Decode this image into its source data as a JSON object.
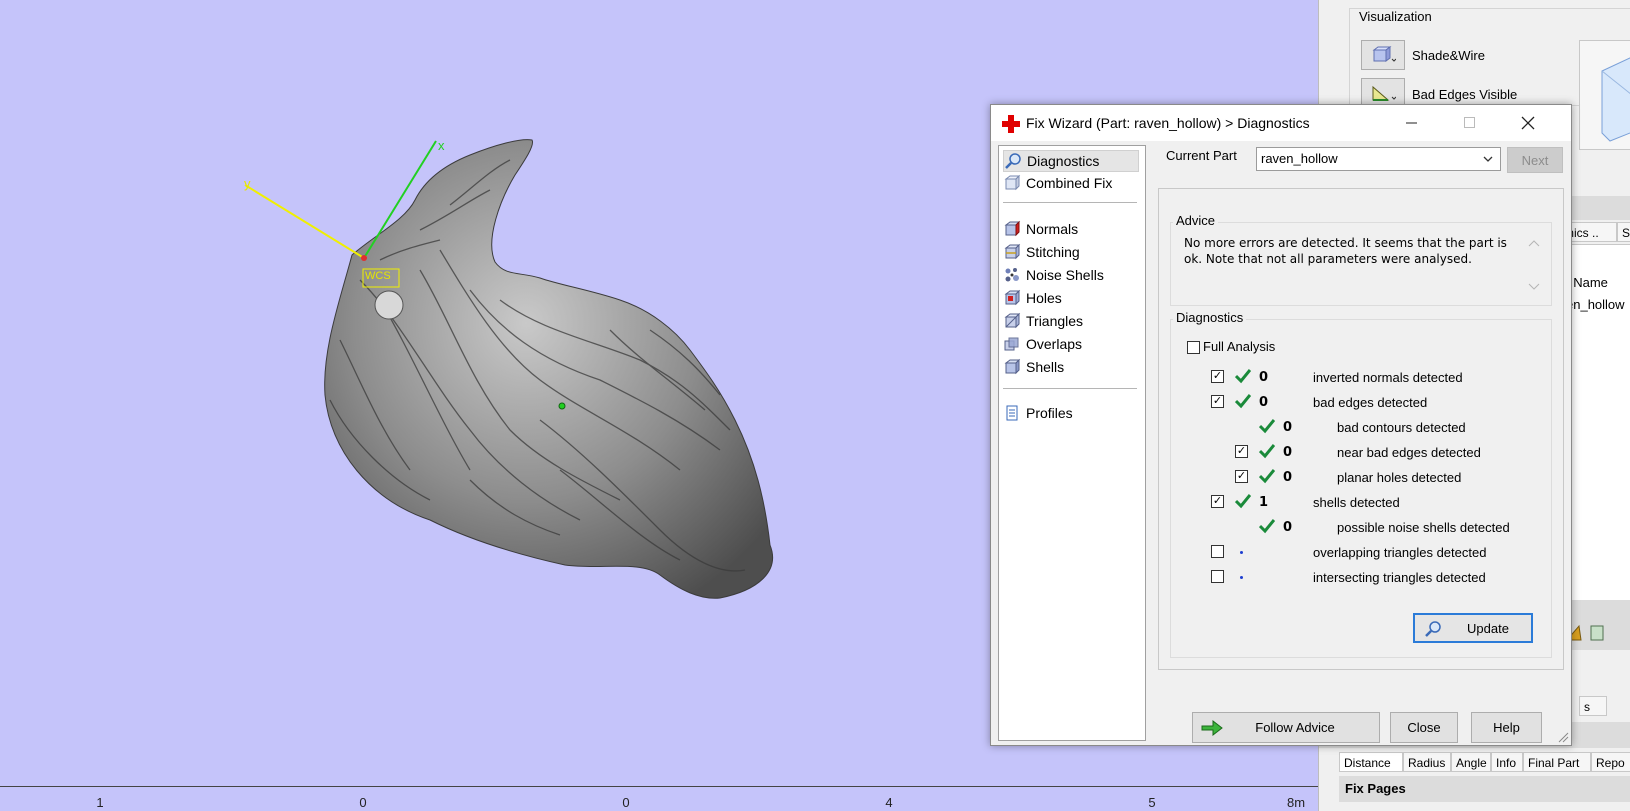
{
  "viewport": {
    "wcs_label": "WCS",
    "axis_x": "x",
    "axis_y": "y",
    "ruler_labels": [
      "1",
      "0",
      "0",
      "4",
      "5",
      "8m"
    ],
    "background": "#c5c4fa"
  },
  "right_panel": {
    "visualization_title": "Visualization",
    "shade_wire_label": "Shade&Wire",
    "bad_edges_label": "Bad Edges Visible",
    "tab_fragments": [
      "mics ..",
      "St"
    ],
    "list_fragments": [
      "t Name",
      "en_hollow"
    ],
    "small_tab": "s",
    "bottom_tabs": [
      "Distance",
      "Radius",
      "Angle",
      "Info",
      "Final Part",
      "Repo"
    ],
    "fix_pages_label": "Fix Pages"
  },
  "dialog": {
    "title": "Fix Wizard (Part: raven_hollow) > Diagnostics",
    "nav_items": [
      "Diagnostics",
      "Combined Fix",
      "Normals",
      "Stitching",
      "Noise Shells",
      "Holes",
      "Triangles",
      "Overlaps",
      "Shells",
      "Profiles"
    ],
    "current_part_label": "Current Part",
    "current_part_value": "raven_hollow",
    "next_button": "Next",
    "advice_title": "Advice",
    "advice_text": "No more errors are detected. It seems that the part is ok. Note that not all parameters were analysed.",
    "diagnostics_title": "Diagnostics",
    "full_analysis_label": "Full Analysis",
    "rows": [
      {
        "count": "0",
        "label": "inverted normals detected",
        "checked": true,
        "status": "ok"
      },
      {
        "count": "0",
        "label": "bad edges detected",
        "checked": true,
        "status": "ok"
      },
      {
        "count": "0",
        "label": "bad contours detected",
        "checked": null,
        "status": "ok"
      },
      {
        "count": "0",
        "label": "near bad edges detected",
        "checked": true,
        "status": "ok"
      },
      {
        "count": "0",
        "label": "planar holes detected",
        "checked": true,
        "status": "ok"
      },
      {
        "count": "1",
        "label": "shells detected",
        "checked": true,
        "status": "ok"
      },
      {
        "count": "0",
        "label": "possible noise shells detected",
        "checked": null,
        "status": "ok"
      },
      {
        "count": "",
        "label": "overlapping triangles detected",
        "checked": false,
        "status": "none"
      },
      {
        "count": "",
        "label": "intersecting triangles detected",
        "checked": false,
        "status": "none"
      }
    ],
    "update_button": "Update",
    "follow_advice_button": "Follow Advice",
    "close_button": "Close",
    "help_button": "Help"
  },
  "colors": {
    "check_green": "#1a8a3a",
    "close_red": "#e00000",
    "dot_blue": "#1e3fd0"
  }
}
